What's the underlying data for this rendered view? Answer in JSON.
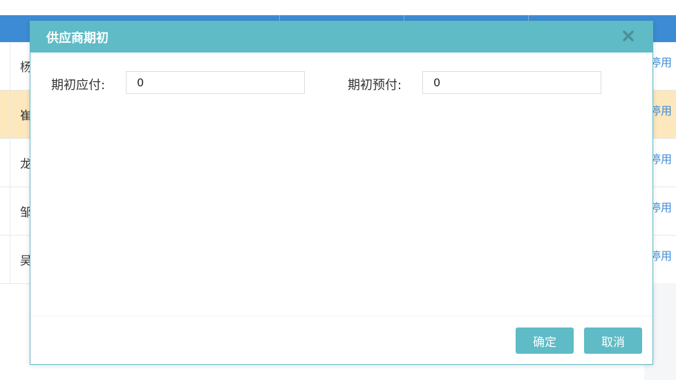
{
  "dialog": {
    "title": "供应商期初",
    "fields": [
      {
        "label": "期初应付:",
        "value": "0"
      },
      {
        "label": "期初预付:",
        "value": "0"
      }
    ],
    "buttons": {
      "ok": "确定",
      "cancel": "取消"
    }
  },
  "background_table": {
    "rows": [
      {
        "name": "杨",
        "action": "停用",
        "highlighted": false
      },
      {
        "name": "崔",
        "action": "停用",
        "highlighted": true
      },
      {
        "name": "龙",
        "action": "停用",
        "highlighted": false
      },
      {
        "name": "邹",
        "action": "停用",
        "highlighted": false
      },
      {
        "name": "吴",
        "action": "停用",
        "highlighted": false
      }
    ]
  },
  "colors": {
    "header_blue": "#3d8bd4",
    "dialog_teal": "#5fbbc5",
    "highlight_row": "#fde7bd",
    "link_blue": "#3d8bd4"
  },
  "icons": {
    "close": "close-icon"
  }
}
